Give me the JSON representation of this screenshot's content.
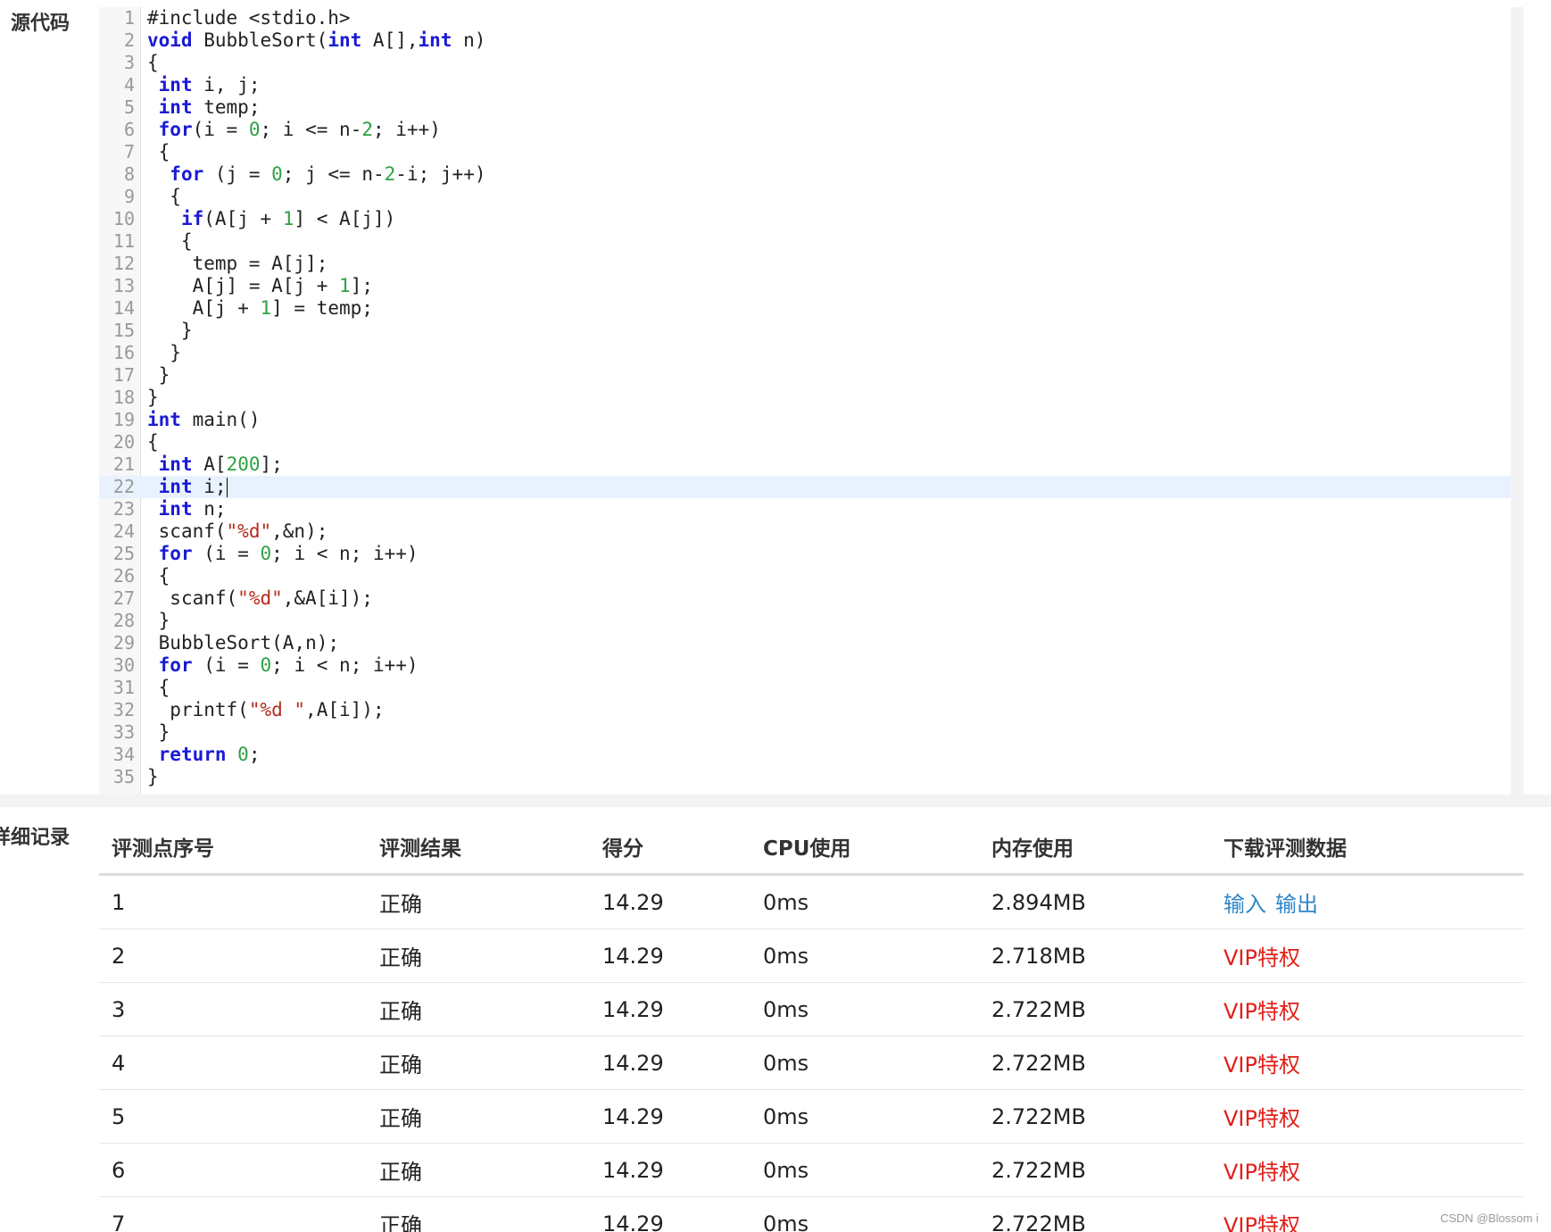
{
  "labels": {
    "source_code": "源代码",
    "detail_records": "详细记录"
  },
  "code": {
    "active_line": 22,
    "lines": [
      "#include <stdio.h>",
      "void BubbleSort(int A[],int n)",
      "{",
      " int i, j;",
      " int temp;",
      " for(i = 0; i <= n-2; i++)",
      " {",
      "  for (j = 0; j <= n-2-i; j++)",
      "  {",
      "   if(A[j + 1] < A[j])",
      "   {",
      "    temp = A[j];",
      "    A[j] = A[j + 1];",
      "    A[j + 1] = temp;",
      "   }",
      "  }",
      " }",
      "}",
      "int main()",
      "{",
      " int A[200];",
      " int i;",
      " int n;",
      " scanf(\"%d\",&n);",
      " for (i = 0; i < n; i++)",
      " {",
      "  scanf(\"%d\",&A[i]);",
      " }",
      " BubbleSort(A,n);",
      " for (i = 0; i < n; i++)",
      " {",
      "  printf(\"%d \",A[i]);",
      " }",
      " return 0;",
      "}"
    ]
  },
  "table": {
    "headers": [
      "评测点序号",
      "评测结果",
      "得分",
      "CPU使用",
      "内存使用",
      "下载评测数据"
    ],
    "rows": [
      {
        "id": "1",
        "result": "正确",
        "score": "14.29",
        "cpu": "0ms",
        "mem": "2.894MB",
        "download": [
          "输入",
          "输出"
        ]
      },
      {
        "id": "2",
        "result": "正确",
        "score": "14.29",
        "cpu": "0ms",
        "mem": "2.718MB",
        "vip": "VIP特权"
      },
      {
        "id": "3",
        "result": "正确",
        "score": "14.29",
        "cpu": "0ms",
        "mem": "2.722MB",
        "vip": "VIP特权"
      },
      {
        "id": "4",
        "result": "正确",
        "score": "14.29",
        "cpu": "0ms",
        "mem": "2.722MB",
        "vip": "VIP特权"
      },
      {
        "id": "5",
        "result": "正确",
        "score": "14.29",
        "cpu": "0ms",
        "mem": "2.722MB",
        "vip": "VIP特权"
      },
      {
        "id": "6",
        "result": "正确",
        "score": "14.29",
        "cpu": "0ms",
        "mem": "2.722MB",
        "vip": "VIP特权"
      },
      {
        "id": "7",
        "result": "正确",
        "score": "14.29",
        "cpu": "0ms",
        "mem": "2.722MB",
        "vip": "VIP特权"
      }
    ]
  },
  "watermark": "CSDN @Blossom i",
  "colors": {
    "keyword": "#1a1ad6",
    "number": "#2ea043",
    "string": "#b52a1d",
    "link": "#2f86c9",
    "vip": "#e0201a",
    "active_line_bg": "#e8f2fe"
  }
}
